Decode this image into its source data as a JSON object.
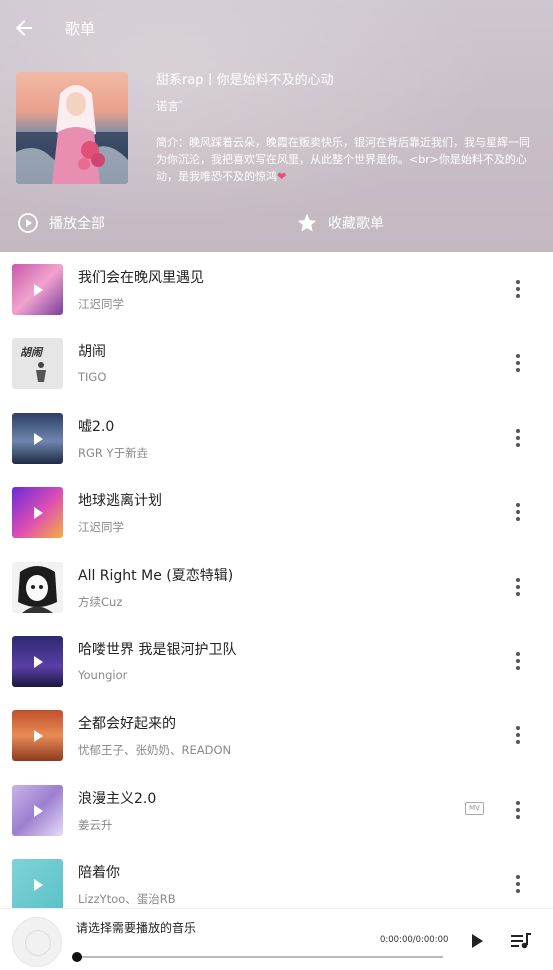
{
  "header": {
    "title": "歌单",
    "playlist_name": "甜系rap丨你是始料不及的心动",
    "creator": "诺言゜",
    "description": "简介：晚风踩着云朵，晚霞在贩卖快乐，银河在背后靠近我们，我与星辉一同为你沉沦，我把喜欢写在风里，从此整个世界是你。<br>你是始料不及的心动，是我唯恐不及的惊鸿",
    "heart": "❤",
    "play_all": "播放全部",
    "collect": "收藏歌单"
  },
  "songs": [
    {
      "title": "我们会在晚风里遇见",
      "artist": "江迟同学",
      "mv": false
    },
    {
      "title": "胡闹",
      "artist": "TIGO",
      "mv": false
    },
    {
      "title": "嘘2.0",
      "artist": "RGR Y于新垚",
      "mv": false
    },
    {
      "title": "地球逃离计划",
      "artist": "江迟同学",
      "mv": false
    },
    {
      "title": "All Right Me (夏恋特辑)",
      "artist": "方续Cuz",
      "mv": false
    },
    {
      "title": "哈喽世界 我是银河护卫队",
      "artist": "Youngior",
      "mv": false
    },
    {
      "title": "全都会好起来的",
      "artist": "忧郁王子、张奶奶、READON",
      "mv": false
    },
    {
      "title": "浪漫主义2.0",
      "artist": "姜云升",
      "mv": true
    },
    {
      "title": "陪着你",
      "artist": "LizzYtoo、蛋治RB",
      "mv": false
    }
  ],
  "mv_label": "MV",
  "cover_text": {
    "song2": "胡闹"
  },
  "player": {
    "now_playing": "请选择需要播放的音乐",
    "time": "0:00:00/0:00:00",
    "progress": 0
  },
  "colors": {
    "header_bg": "#c9bfc8",
    "accent_heart": "#e0507a"
  }
}
